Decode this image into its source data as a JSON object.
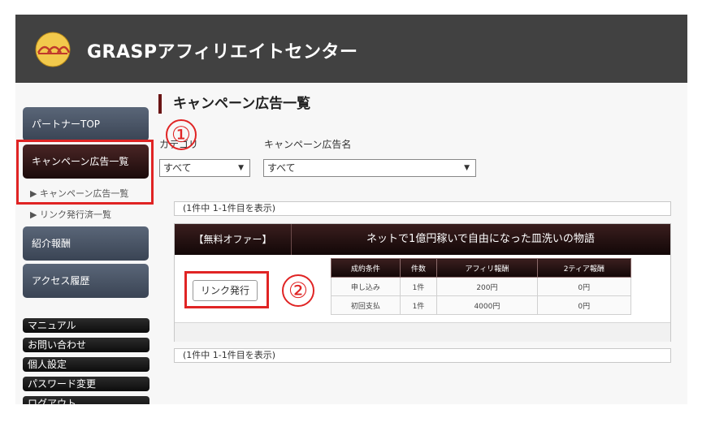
{
  "header": {
    "title": "GRASPアフィリエイトセンター",
    "logo": "grasp-logo"
  },
  "page": {
    "title": "キャンペーン広告一覧"
  },
  "sidebar": {
    "buttons": [
      {
        "label": "パートナーTOP"
      },
      {
        "label": "キャンペーン広告一覧"
      },
      {
        "label": "紹介報酬"
      },
      {
        "label": "アクセス履歴"
      }
    ],
    "sub_items": [
      {
        "label": "▶ キャンペーン広告一覧"
      },
      {
        "label": "▶ リンク発行済一覧"
      }
    ],
    "menu": [
      {
        "label": "マニュアル"
      },
      {
        "label": "お問い合わせ"
      },
      {
        "label": "個人設定"
      },
      {
        "label": "パスワード変更"
      },
      {
        "label": "ログアウト"
      }
    ]
  },
  "filters": {
    "category_label": "カテゴリ",
    "category_value": "すべて",
    "campaign_label": "キャンペーン広告名",
    "campaign_value": "すべて"
  },
  "result_count": "(1件中 1-1件目を表示)",
  "offer": {
    "tag": "【無料オファー】",
    "name": "ネットで1億円稼いで自由になった皿洗いの物語",
    "link_button": "リンク発行",
    "table": {
      "headers": [
        "成約条件",
        "件数",
        "アフィリ報酬",
        "2ティア報酬"
      ],
      "rows": [
        [
          "申し込み",
          "1件",
          "200円",
          "0円"
        ],
        [
          "初回支払",
          "1件",
          "4000円",
          "0円"
        ]
      ]
    }
  },
  "annotations": {
    "one": "①",
    "two": "②"
  },
  "colors": {
    "header_bg": "#414141",
    "accent_red": "#e02424",
    "dark_maroon": "#1b0b0b"
  }
}
